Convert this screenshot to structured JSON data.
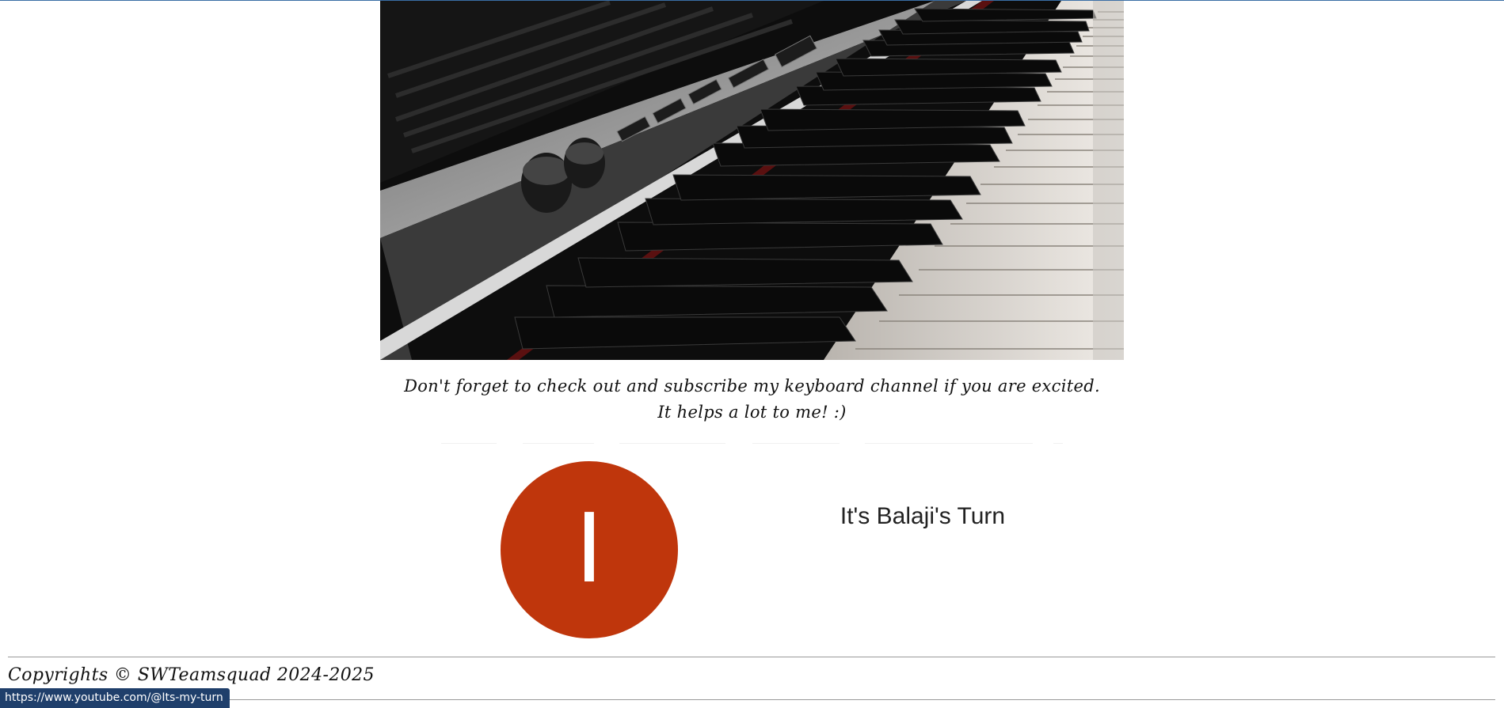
{
  "hero": {
    "image": "piano-keyboard-photo"
  },
  "caption": {
    "line1": "Don't forget to check out and subscribe my keyboard channel if you are excited.",
    "line2": "It helps a lot to me! :)"
  },
  "channel": {
    "avatar_letter": "I",
    "avatar_color": "#bf360c",
    "name": "It's Balaji's Turn"
  },
  "footer": {
    "copyright": "Copyrights © SWTeamsquad 2024-2025"
  },
  "status_bar": {
    "url": "https://www.youtube.com/@Its-my-turn"
  }
}
